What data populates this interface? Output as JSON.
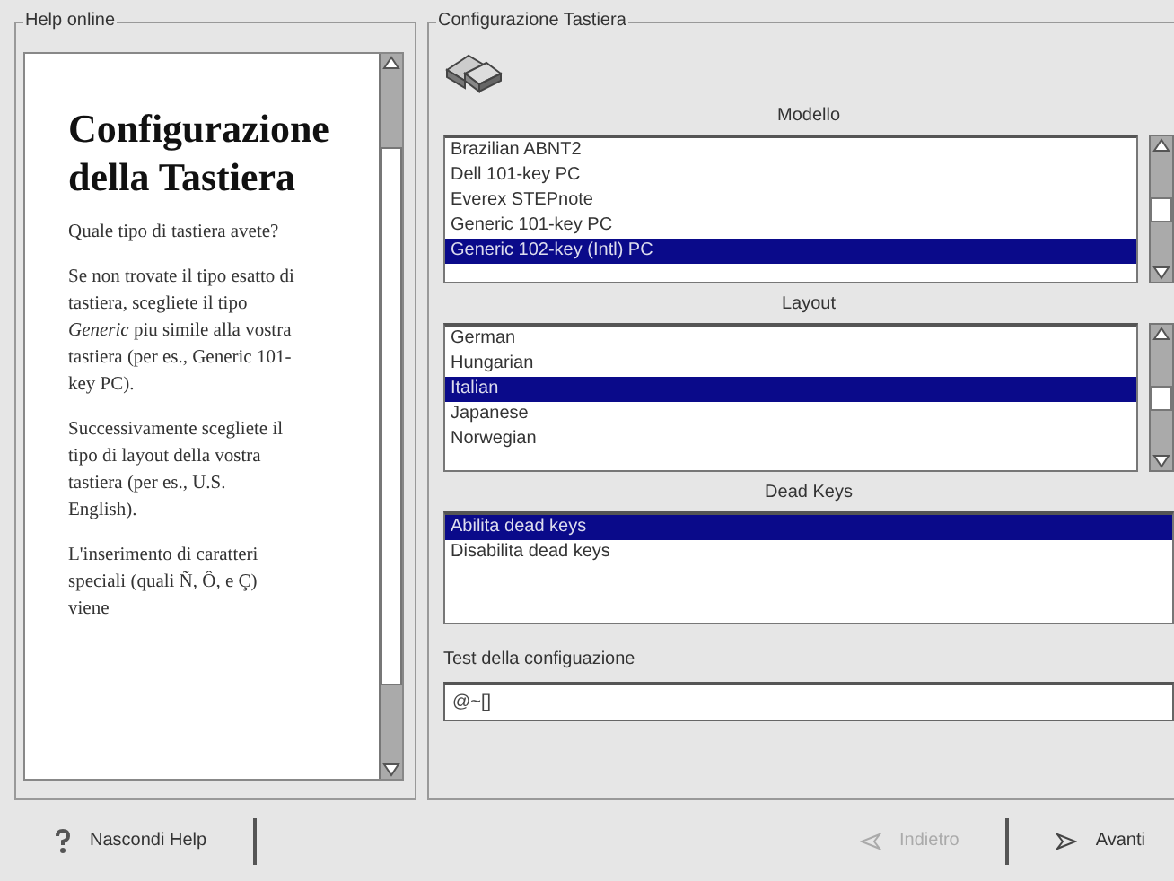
{
  "help_panel": {
    "title": "Help online",
    "heading": "Configurazione della Tastiera",
    "paragraphs": [
      "Quale tipo di tastiera avete?",
      "Se non trovate il tipo esatto di tastiera, scegliete il tipo *Generic* piu simile alla vostra tastiera (per es., Generic 101-key PC).",
      "Successivamente scegliete il tipo di layout della vostra tastiera (per es., U.S. English).",
      "L'inserimento di caratteri speciali (quali Ñ, Ô, e Ç) viene"
    ]
  },
  "config_panel": {
    "title": "Configurazione Tastiera",
    "lists": [
      {
        "label": "Modello",
        "scrollbar": true,
        "items": [
          {
            "text": "Brazilian ABNT2",
            "selected": false
          },
          {
            "text": "Dell 101-key PC",
            "selected": false
          },
          {
            "text": "Everex STEPnote",
            "selected": false
          },
          {
            "text": "Generic 101-key PC",
            "selected": false
          },
          {
            "text": "Generic 102-key (Intl) PC",
            "selected": true
          }
        ]
      },
      {
        "label": "Layout",
        "scrollbar": true,
        "items": [
          {
            "text": "German",
            "selected": false
          },
          {
            "text": "Hungarian",
            "selected": false
          },
          {
            "text": "Italian",
            "selected": true
          },
          {
            "text": "Japanese",
            "selected": false
          },
          {
            "text": "Norwegian",
            "selected": false
          }
        ]
      },
      {
        "label": "Dead Keys",
        "scrollbar": false,
        "items": [
          {
            "text": "Abilita dead keys",
            "selected": true
          },
          {
            "text": "Disabilita dead keys",
            "selected": false
          }
        ]
      }
    ],
    "test_label": "Test della configuazione",
    "test_value": "@~[]"
  },
  "buttons": [
    {
      "kind": "help",
      "label": "Nascondi Help",
      "disabled": false
    },
    {
      "kind": "back",
      "label": "Indietro",
      "disabled": true
    },
    {
      "kind": "next",
      "label": "Avanti",
      "disabled": false
    }
  ]
}
